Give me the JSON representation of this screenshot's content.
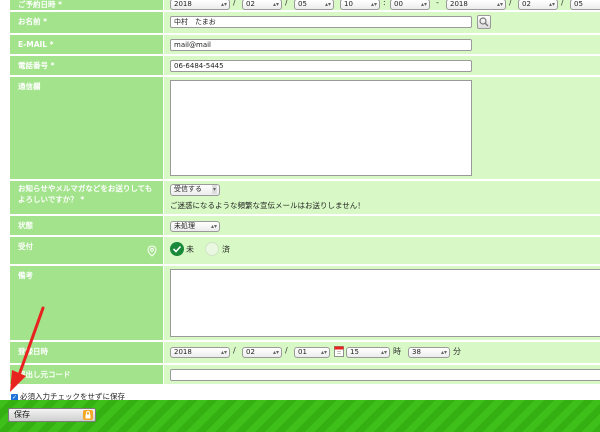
{
  "reservation": {
    "label": "ご予約日時 *",
    "start": {
      "year": "2018",
      "month": "02",
      "day": "05",
      "hour": "10",
      "minute": "00"
    },
    "range_sep": "-",
    "end": {
      "year": "2018",
      "month": "02",
      "day": "05"
    },
    "slash": "/",
    "colon": ":"
  },
  "name": {
    "label": "お名前 *",
    "value": "中村　たまお"
  },
  "email": {
    "label": "E-MAIL *",
    "value": "mail@mail"
  },
  "phone": {
    "label": "電話番号 *",
    "value": "06-6484-5445"
  },
  "comments": {
    "label": "通信欄",
    "value": ""
  },
  "newsletter": {
    "label": "お知らせやメルマガなどをお送りしてもよろしいですか？ *",
    "selected": "受信する",
    "note": "ご迷惑になるような頻繁な宣伝メールはお送りしません！"
  },
  "status": {
    "label": "状態",
    "selected": "未処理"
  },
  "acceptance": {
    "label": "受付",
    "options": [
      "未",
      "済"
    ],
    "selected": "未"
  },
  "notes": {
    "label": "備考",
    "value": ""
  },
  "registered": {
    "label": "登録日時",
    "year": "2018",
    "month": "02",
    "day": "01",
    "hour": "15",
    "hour_unit": "時",
    "minute": "38",
    "minute_unit": "分"
  },
  "source_code": {
    "label": "呼出し元コード",
    "value": ""
  },
  "skip_check": {
    "label": "必須入力チェックをせずに保存",
    "checked": true
  },
  "save_button": {
    "label": "保存"
  },
  "colors": {
    "label_bg": "#a2e38b",
    "field_bg": "#d8f9c6",
    "accent": "#1a8a3a",
    "bar": "#3fbf1a",
    "annotation": "#e8231f"
  }
}
